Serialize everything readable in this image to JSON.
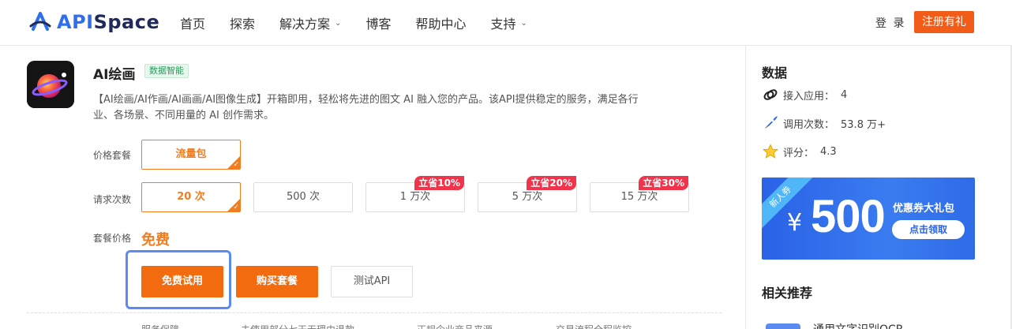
{
  "header": {
    "logo_text_a": "API",
    "logo_text_b": "Space",
    "nav": [
      {
        "label": "首页",
        "dropdown": false
      },
      {
        "label": "探索",
        "dropdown": false
      },
      {
        "label": "解决方案",
        "dropdown": true
      },
      {
        "label": "博客",
        "dropdown": false
      },
      {
        "label": "帮助中心",
        "dropdown": false
      },
      {
        "label": "支持",
        "dropdown": true
      }
    ],
    "login_label": "登 录",
    "register_label": "注册有礼"
  },
  "product": {
    "title": "AI绘画",
    "tag": "数据智能",
    "description": "【AI绘画/AI作画/AI画画/AI图像生成】开箱即用，轻松将先进的图文 AI 融入您的产品。该API提供稳定的服务，满足各行业、各场景、不同用量的 AI 创作需求。"
  },
  "pricing": {
    "package_label": "价格套餐",
    "package_option": "流量包",
    "requests_label": "请求次数",
    "request_options": [
      {
        "label": "20 次",
        "selected": true,
        "badge": ""
      },
      {
        "label": "500 次",
        "selected": false,
        "badge": ""
      },
      {
        "label": "1 万次",
        "selected": false,
        "badge": "立省10%"
      },
      {
        "label": "5 万次",
        "selected": false,
        "badge": "立省20%"
      },
      {
        "label": "15 万次",
        "selected": false,
        "badge": "立省30%"
      }
    ],
    "price_label": "套餐价格",
    "price_value": "免费"
  },
  "actions": {
    "free_trial": "免费试用",
    "buy": "购买套餐",
    "test_api": "测试API"
  },
  "guarantees": [
    "服务保障",
    "未使用部分七天无理由退款",
    "正规企业商品来源",
    "交易流程全程监控"
  ],
  "sidebar": {
    "data_heading": "数据",
    "stats": [
      {
        "icon": "link-icon",
        "label": "接入应用：",
        "value": "4"
      },
      {
        "icon": "rocket-icon",
        "label": "调用次数：",
        "value": "53.8 万+"
      },
      {
        "icon": "star-icon",
        "label": "评分：",
        "value": "4.3"
      }
    ],
    "coupon": {
      "ribbon": "新人券",
      "currency": "¥",
      "amount": "500",
      "title": "优惠券大礼包",
      "button": "点击领取",
      "color": "#2a62e6"
    },
    "related_heading": "相关推荐",
    "related_first": "通用文字识别OCR"
  },
  "colors": {
    "accent": "#f26b0f",
    "brand_blue": "#2f6fec",
    "badge_red": "#f0344c",
    "focus_ring": "#5b8bf0"
  }
}
